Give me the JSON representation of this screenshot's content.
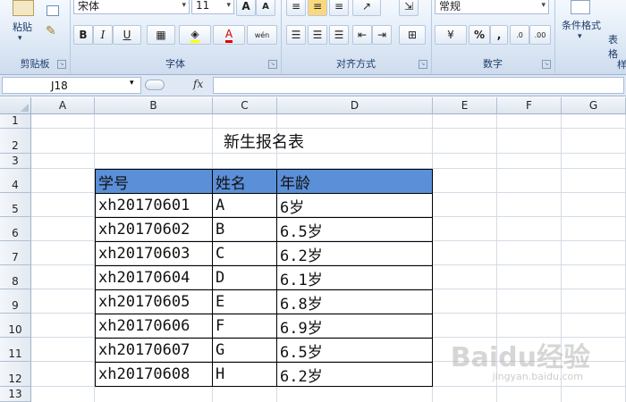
{
  "ribbon": {
    "clipboard": {
      "paste_label": "粘贴",
      "group_label": "剪贴板"
    },
    "font": {
      "font_name": "宋体",
      "font_size": "11",
      "bold": "B",
      "italic": "I",
      "underline": "U",
      "font_color_glyph": "A",
      "wen_glyph": "wén",
      "group_label": "字体"
    },
    "alignment": {
      "group_label": "对齐方式"
    },
    "number": {
      "format_value": "常规",
      "percent": "%",
      "comma": ",",
      "group_label": "数字"
    },
    "styles": {
      "conditional_format": "条件格式",
      "table_fmt_partial": "表格",
      "group_label_partial": "样"
    }
  },
  "formula_bar": {
    "cell_ref": "J18",
    "fx_label": "fx",
    "formula": ""
  },
  "columns": [
    "A",
    "B",
    "C",
    "D",
    "E",
    "F",
    "G"
  ],
  "rows": [
    "1",
    "2",
    "3",
    "4",
    "5",
    "6",
    "7",
    "8",
    "9",
    "10",
    "11",
    "12",
    "13"
  ],
  "sheet": {
    "title": "新生报名表",
    "headers": [
      "学号",
      "姓名",
      "年龄"
    ],
    "records": [
      [
        "xh20170601",
        "A",
        "6岁"
      ],
      [
        "xh20170602",
        "B",
        "6.5岁"
      ],
      [
        "xh20170603",
        "C",
        "6.2岁"
      ],
      [
        "xh20170604",
        "D",
        "6.1岁"
      ],
      [
        "xh20170605",
        "E",
        "6.8岁"
      ],
      [
        "xh20170606",
        "F",
        "6.9岁"
      ],
      [
        "xh20170607",
        "G",
        "6.5岁"
      ],
      [
        "xh20170608",
        "H",
        "6.2岁"
      ]
    ]
  },
  "watermark": {
    "brand": "Baidu经验",
    "url": "jingyan.baidu.com"
  },
  "colors": {
    "header_fill": "#5b8fd8",
    "ribbon_bg": "#dde8f5",
    "label_text": "#1e3d6b"
  }
}
